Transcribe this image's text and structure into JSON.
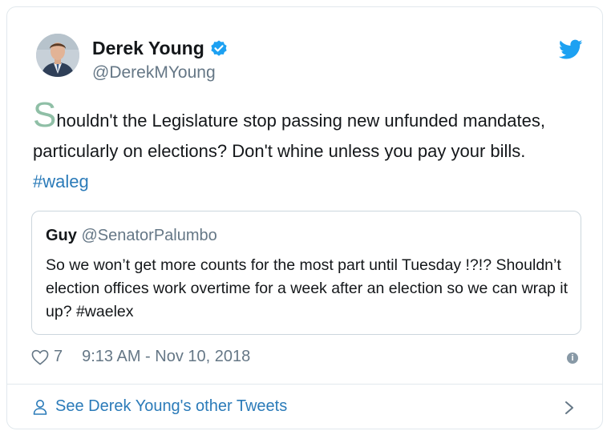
{
  "author": {
    "name": "Derek Young",
    "handle": "@DerekMYoung",
    "verified": true,
    "avatar_icon": "profile-photo"
  },
  "tweet": {
    "dropcap": "S",
    "text": "houldn't the Legislature stop passing new unfunded mandates, particularly on elections? Don't whine unless you pay your bills. ",
    "hashtag": "#waleg"
  },
  "quoted_tweet": {
    "name": "Guy",
    "handle": "@SenatorPalumbo",
    "text": "So we won’t get more counts for the most part until Tuesday !?!? Shouldn’t election offices work overtime for a week after an election so we can wrap it up? #waelex"
  },
  "meta": {
    "likes": "7",
    "timestamp": "9:13 AM - Nov 10, 2018",
    "info_glyph": "i"
  },
  "footer": {
    "link_label": "See Derek Young's other Tweets"
  },
  "colors": {
    "brand_blue": "#1da1f2",
    "link_blue": "#2b7bb9",
    "muted": "#657786",
    "dropcap": "#8fbfa6"
  }
}
